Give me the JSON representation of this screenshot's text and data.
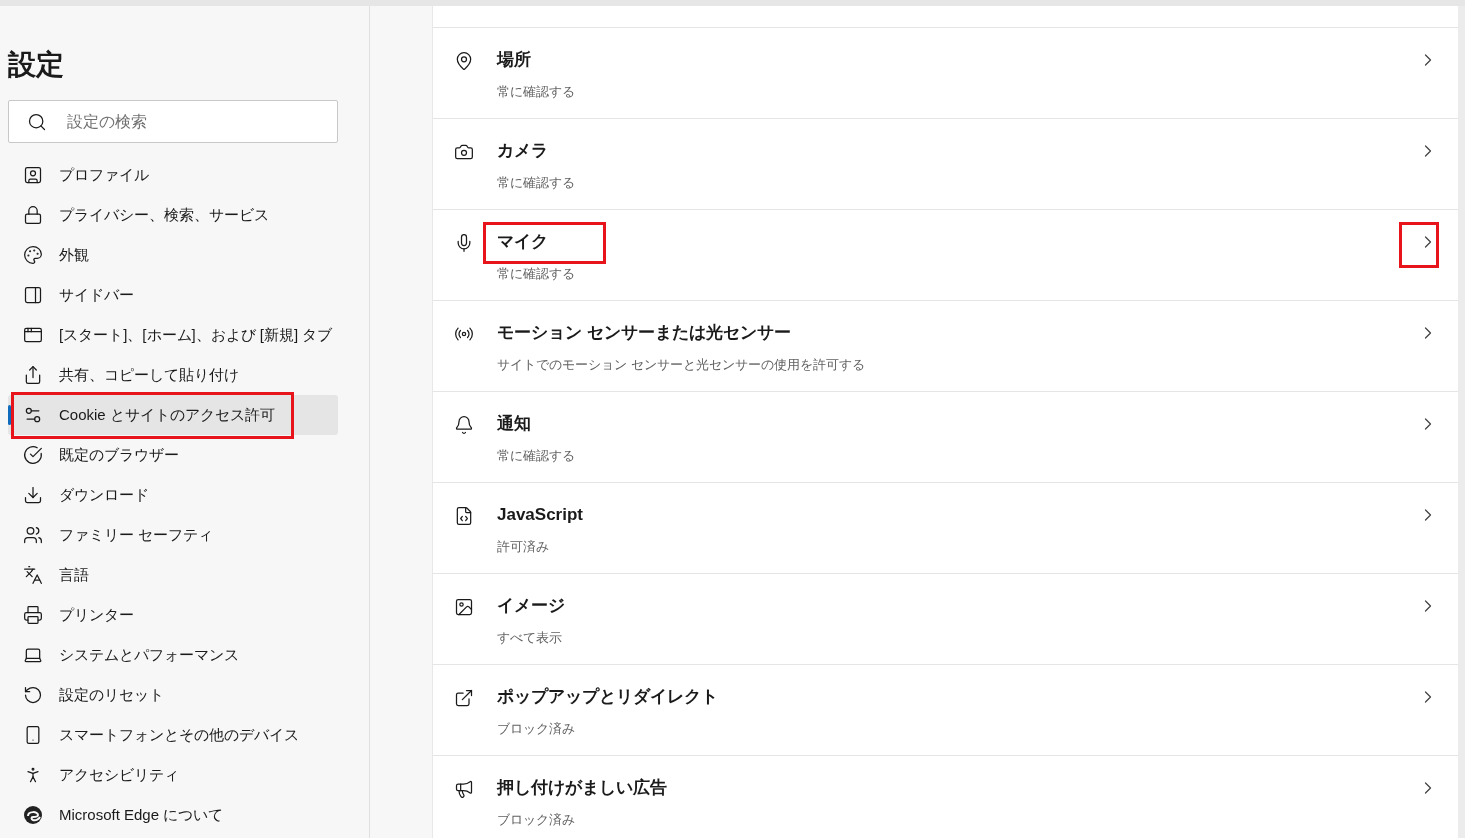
{
  "sidebar": {
    "title": "設定",
    "search": {
      "placeholder": "設定の検索"
    },
    "items": [
      {
        "label": "プロファイル",
        "selected": false,
        "highlighted": false
      },
      {
        "label": "プライバシー、検索、サービス",
        "selected": false,
        "highlighted": false
      },
      {
        "label": "外観",
        "selected": false,
        "highlighted": false
      },
      {
        "label": "サイドバー",
        "selected": false,
        "highlighted": false
      },
      {
        "label": "[スタート]、[ホーム]、および [新規] タブ",
        "selected": false,
        "highlighted": false
      },
      {
        "label": "共有、コピーして貼り付け",
        "selected": false,
        "highlighted": false
      },
      {
        "label": "Cookie とサイトのアクセス許可",
        "selected": true,
        "highlighted": true
      },
      {
        "label": "既定のブラウザー",
        "selected": false,
        "highlighted": false
      },
      {
        "label": "ダウンロード",
        "selected": false,
        "highlighted": false
      },
      {
        "label": "ファミリー セーフティ",
        "selected": false,
        "highlighted": false
      },
      {
        "label": "言語",
        "selected": false,
        "highlighted": false
      },
      {
        "label": "プリンター",
        "selected": false,
        "highlighted": false
      },
      {
        "label": "システムとパフォーマンス",
        "selected": false,
        "highlighted": false
      },
      {
        "label": "設定のリセット",
        "selected": false,
        "highlighted": false
      },
      {
        "label": "スマートフォンとその他のデバイス",
        "selected": false,
        "highlighted": false
      },
      {
        "label": "アクセシビリティ",
        "selected": false,
        "highlighted": false
      },
      {
        "label": "Microsoft Edge について",
        "selected": false,
        "highlighted": false
      }
    ]
  },
  "permissions": [
    {
      "title": "場所",
      "subtitle": "常に確認する",
      "title_highlighted": false,
      "chevron_highlighted": false
    },
    {
      "title": "カメラ",
      "subtitle": "常に確認する",
      "title_highlighted": false,
      "chevron_highlighted": false
    },
    {
      "title": "マイク",
      "subtitle": "常に確認する",
      "title_highlighted": true,
      "chevron_highlighted": true
    },
    {
      "title": "モーション センサーまたは光センサー",
      "subtitle": "サイトでのモーション センサーと光センサーの使用を許可する",
      "title_highlighted": false,
      "chevron_highlighted": false
    },
    {
      "title": "通知",
      "subtitle": "常に確認する",
      "title_highlighted": false,
      "chevron_highlighted": false
    },
    {
      "title": "JavaScript",
      "subtitle": "許可済み",
      "title_highlighted": false,
      "chevron_highlighted": false
    },
    {
      "title": "イメージ",
      "subtitle": "すべて表示",
      "title_highlighted": false,
      "chevron_highlighted": false
    },
    {
      "title": "ポップアップとリダイレクト",
      "subtitle": "ブロック済み",
      "title_highlighted": false,
      "chevron_highlighted": false
    },
    {
      "title": "押し付けがましい広告",
      "subtitle": "ブロック済み",
      "title_highlighted": false,
      "chevron_highlighted": false
    }
  ]
}
